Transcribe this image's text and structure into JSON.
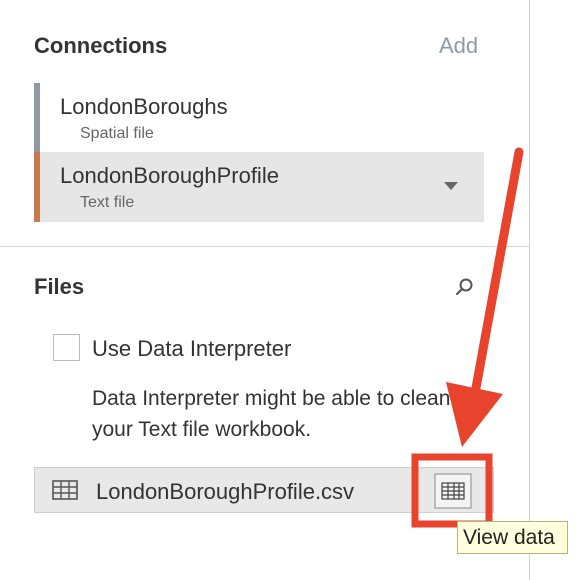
{
  "connections": {
    "title": "Connections",
    "add_label": "Add",
    "items": [
      {
        "name": "LondonBoroughs",
        "type": "Spatial file",
        "bar_color": "#8e9aa5"
      },
      {
        "name": "LondonBoroughProfile",
        "type": "Text file",
        "bar_color": "#c87a4b"
      }
    ]
  },
  "files": {
    "title": "Files",
    "use_interpreter_label": "Use Data Interpreter",
    "interpreter_hint": "Data Interpreter might be able to clean your Text file workbook.",
    "file_name": "LondonBoroughProfile.csv",
    "view_data_tooltip": "View data"
  },
  "annotation": {
    "highlight_color": "#e8432d"
  }
}
